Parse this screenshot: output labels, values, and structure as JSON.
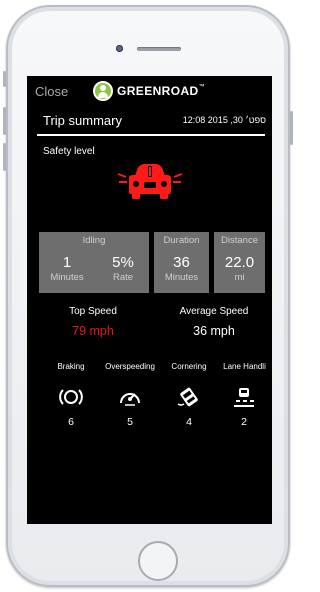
{
  "header": {
    "close_label": "Close",
    "brand_name": "GREENROAD",
    "brand_mark": "™"
  },
  "trip": {
    "title": "Trip summary",
    "date": "12:08 2015 ,30 ספט׳"
  },
  "safety": {
    "label": "Safety level",
    "icon": "car-icon",
    "color": "#ff1a1a"
  },
  "stats": {
    "idling": {
      "label": "Idling",
      "minutes_value": "1",
      "minutes_unit": "Minutes",
      "rate_value": "5%",
      "rate_unit": "Rate"
    },
    "duration": {
      "label": "Duration",
      "value": "36",
      "unit": "Minutes"
    },
    "distance": {
      "label": "Distance",
      "value": "22.0",
      "unit": "mi"
    }
  },
  "speed": {
    "top_label": "Top Speed",
    "top_value": "79 mph",
    "top_color": "#e31b1b",
    "avg_label": "Average Speed",
    "avg_value": "36 mph"
  },
  "events": [
    {
      "label": "Braking",
      "count": "6",
      "icon": "braking-icon"
    },
    {
      "label": "Overspeeding",
      "count": "5",
      "icon": "overspeeding-icon"
    },
    {
      "label": "Cornering",
      "count": "4",
      "icon": "cornering-icon"
    },
    {
      "label": "Lane Handli",
      "count": "2",
      "icon": "lane-handling-icon"
    }
  ],
  "colors": {
    "brand_green": "#8dc63f",
    "stat_box": "#6e6e6e"
  }
}
